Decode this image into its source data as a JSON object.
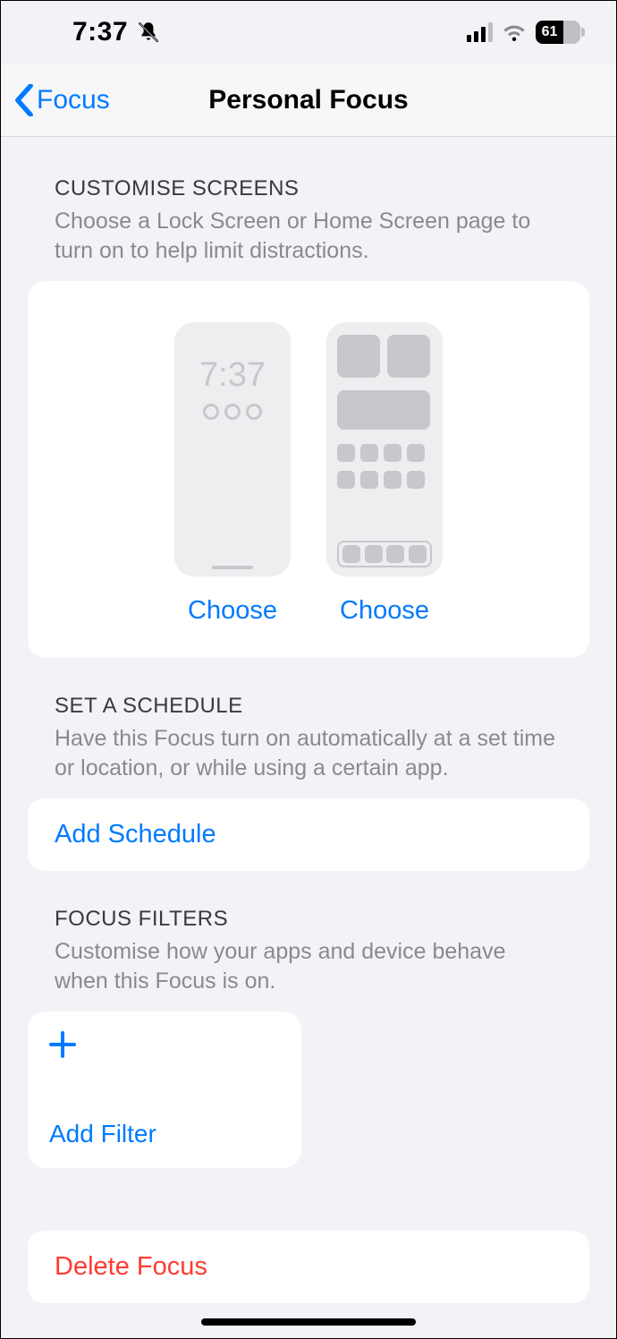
{
  "status": {
    "time": "7:37",
    "battery_pct": "61"
  },
  "nav": {
    "back_label": "Focus",
    "title": "Personal Focus"
  },
  "sections": {
    "screens": {
      "header": "Customise Screens",
      "desc": "Choose a Lock Screen or Home Screen page to turn on to help limit distractions.",
      "lock_time": "7:37",
      "choose_lock": "Choose",
      "choose_home": "Choose"
    },
    "schedule": {
      "header": "Set a Schedule",
      "desc": "Have this Focus turn on automatically at a set time or location, or while using a certain app.",
      "add_label": "Add Schedule"
    },
    "filters": {
      "header": "Focus Filters",
      "desc": "Customise how your apps and device behave when this Focus is on.",
      "add_label": "Add Filter"
    },
    "delete_label": "Delete Focus"
  }
}
